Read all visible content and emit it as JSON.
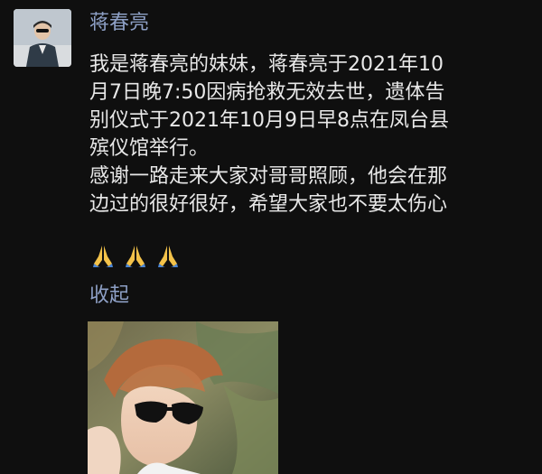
{
  "post": {
    "author": "蒋春亮",
    "text_lines": [
      "我是蒋春亮的妹妹，蒋春亮于2021年10",
      "月7日晚7:50因病抢救无效去世，遗体告",
      "别仪式于2021年10月9日早8点在凤台县",
      "殡仪馆举行。"
    ],
    "text_lines_2": [
      "感谢一路走来大家对哥哥照顾，他会在那",
      "边过的很好很好，希望大家也不要太伤心"
    ],
    "emojis": [
      "folded-hands-icon",
      "folded-hands-icon",
      "folded-hands-icon"
    ],
    "collapse_label": "收起"
  },
  "colors": {
    "background": "#0f0f0f",
    "author_link": "#8ea0c6",
    "text": "#e8e8e8"
  }
}
